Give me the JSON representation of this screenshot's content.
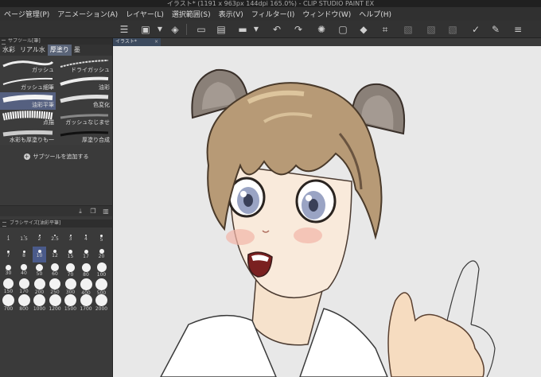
{
  "window": {
    "title": "イラスト* (1191 x 963px 144dpi 165.0%) - CLIP STUDIO PAINT EX"
  },
  "menu": [
    "ページ管理(P)",
    "アニメーション(A)",
    "レイヤー(L)",
    "選択範囲(S)",
    "表示(V)",
    "フィルター(I)",
    "ウィンドウ(W)",
    "ヘルプ(H)"
  ],
  "subtool_panel": {
    "header": "サブツール[筆]",
    "tabs": [
      "水彩",
      "リアル水",
      "厚塗り",
      "墨"
    ],
    "active_tab": 2,
    "brushes": [
      "ガッシュ",
      "ドライガッシュ",
      "ガッシュ細筆",
      "油彩",
      "油彩平筆",
      "色変化",
      "点描",
      "ガッシュなじませ",
      "水彩も厚塗りも一",
      "厚塗り合成"
    ],
    "selected_brush": 4,
    "add_button": "サブツールを追加する"
  },
  "brush_size_panel": {
    "header": "ブラシサイズ[油彩平筆]",
    "sizes": [
      "1",
      "1.5",
      "2",
      "2.5",
      "3",
      "4",
      "5",
      "7",
      "8",
      "10",
      "12",
      "15",
      "17",
      "20",
      "30",
      "40",
      "50",
      "60",
      "70",
      "80",
      "100",
      "150",
      "170",
      "200",
      "250",
      "300",
      "400",
      "500",
      "700",
      "800",
      "1000",
      "1200",
      "1500",
      "1700",
      "2000"
    ],
    "selected_size": "10"
  },
  "canvas": {
    "doc_tab": "イラスト*"
  },
  "icons": [
    "menu-icon",
    "transform-icon",
    "chevron-down-icon",
    "snap-icon",
    "new-file-icon",
    "open-file-icon",
    "save-icon",
    "export-icon",
    "chevron-down-icon",
    "undo-icon",
    "redo-icon",
    "loading-icon",
    "clear-icon",
    "fill-icon",
    "crop-icon",
    "ruler-icon",
    "pen-icon",
    "brush-icon",
    "settings-icon"
  ]
}
